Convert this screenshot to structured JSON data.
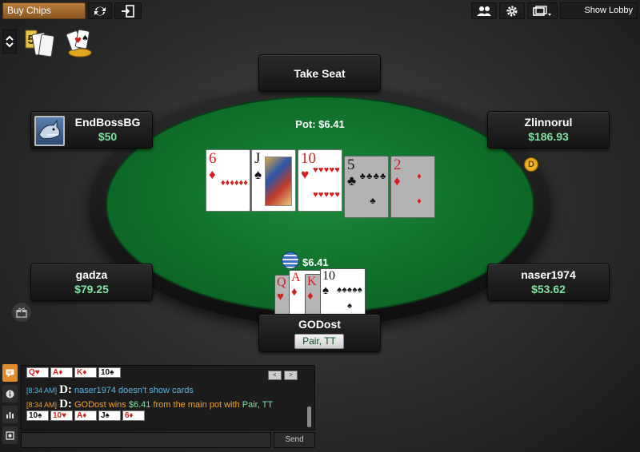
{
  "toolbar": {
    "buy_chips": "Buy Chips",
    "show_lobby": "Show Lobby",
    "icons": [
      "refresh-icon",
      "leave-table-icon",
      "players-icon",
      "gear-icon",
      "window-icon"
    ]
  },
  "table": {
    "pot": "Pot: $6.41",
    "take_seat": "Take Seat",
    "bet_amount": "$6.41",
    "dealer_marker": "D",
    "board": [
      {
        "rank": "6",
        "suit": "♦",
        "color": "red",
        "dimmed": false
      },
      {
        "rank": "J",
        "suit": "♠",
        "color": "black",
        "dimmed": false
      },
      {
        "rank": "10",
        "suit": "♥",
        "color": "red",
        "dimmed": false
      },
      {
        "rank": "5",
        "suit": "♣",
        "color": "black",
        "dimmed": true
      },
      {
        "rank": "2",
        "suit": "♦",
        "color": "red",
        "dimmed": true
      }
    ]
  },
  "seats": [
    {
      "name": "EndBossBG",
      "stack": "$50"
    },
    {
      "name": "Zlinnorul",
      "stack": "$186.93"
    },
    {
      "name": "gadza",
      "stack": "$79.25"
    },
    {
      "name": "naser1974",
      "stack": "$53.62"
    }
  ],
  "hero": {
    "name": "GODost",
    "hand": "Pair, TT",
    "cards": [
      {
        "rank": "Q",
        "suit": "♥",
        "color": "red",
        "dimmed": true
      },
      {
        "rank": "A",
        "suit": "♦",
        "color": "red",
        "dimmed": false
      },
      {
        "rank": "K",
        "suit": "♦",
        "color": "red",
        "dimmed": true
      },
      {
        "rank": "10",
        "suit": "♠",
        "color": "black",
        "dimmed": false
      }
    ]
  },
  "chat": {
    "top_cards": [
      "Q♥",
      "A♦",
      "K♦",
      "10♠"
    ],
    "line1": {
      "time": "[8:34 AM]",
      "logo": "D:",
      "text": "naser1974  doesn't show cards"
    },
    "line2": {
      "time": "[8:34 AM]",
      "logo": "D:",
      "player": "GODost",
      "wins": "wins",
      "amount": "$6.41",
      "mid": "from the main pot with",
      "hand": "Pair, TT"
    },
    "bottom_cards": [
      "10♠",
      "10♥",
      "A♦",
      "J♠",
      "6♦"
    ],
    "send": "Send",
    "nav_prev": "<",
    "nav_next": ">"
  },
  "colors": {
    "felt": "#0f6e2a",
    "stack_green": "#7fe3a0",
    "buy_chips_bg": "#a06a2c",
    "chat_active_tab": "#e08a2a",
    "chat_blue": "#4fb8e8",
    "chat_orange": "#f0a030"
  }
}
